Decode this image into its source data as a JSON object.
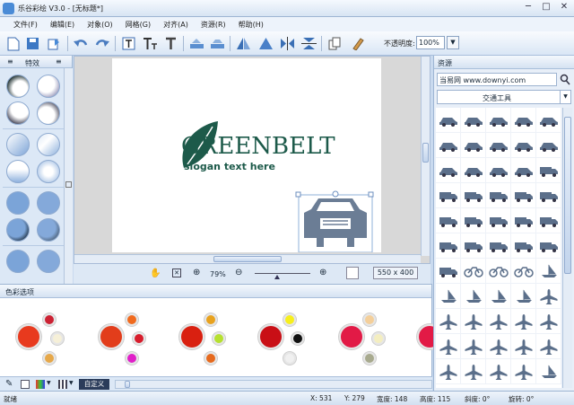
{
  "window": {
    "title": "乐谷彩绘 V3.0 - [无标题*]",
    "controls": [
      "─",
      "□",
      "✕"
    ]
  },
  "menu": [
    "文件(F)",
    "编辑(E)",
    "对象(O)",
    "网格(G)",
    "对齐(A)",
    "资源(R)",
    "帮助(H)"
  ],
  "toolbar": {
    "opacity_label": "不透明度:",
    "opacity_value": "100%",
    "buttons": [
      "new-file-icon",
      "save-icon",
      "export-icon",
      "undo-icon",
      "redo-icon",
      "text-box-icon",
      "text-style-icon",
      "text-icon",
      "flip-h-icon",
      "flip-v-icon",
      "align-left-icon",
      "align-center-icon",
      "mirror-icon",
      "mirror-v-icon",
      "copy-icon",
      "clear-icon"
    ]
  },
  "effects": {
    "title": "特效"
  },
  "canvas": {
    "logo_text": "GREENBELT",
    "slogan": "slogan text here",
    "brand_color": "#1d5a4a",
    "car_color": "#6b7d95"
  },
  "zoom": {
    "value": "79%",
    "size": "550 x 400"
  },
  "colors": {
    "title": "色彩选项",
    "custom_label": "自定义",
    "sets": [
      {
        "main": "#e83a1e",
        "a": "#cc2233",
        "b": "#f6f0d8",
        "c": "#e6a84a"
      },
      {
        "main": "#e23d1b",
        "a": "#f06a1e",
        "b": "#d71d2c",
        "c": "#e020c8"
      },
      {
        "main": "#d92010",
        "a": "#e8a21e",
        "b": "#b6e030",
        "c": "#e66a1e"
      },
      {
        "main": "#c90f16",
        "a": "#f7ef1c",
        "b": "#111111",
        "c": "#f0f0f0"
      },
      {
        "main": "#e21a46",
        "a": "#f4cf9a",
        "b": "#f4eec0",
        "c": "#a8aa8e"
      },
      {
        "main": "#e21a46",
        "a": "",
        "b": "",
        "c": ""
      }
    ]
  },
  "resources": {
    "title": "资源",
    "search_value": "当易网 www.downyi.com",
    "category": "交通工具"
  },
  "status": {
    "ready": "就绪",
    "x": "X: 531",
    "y": "Y: 279",
    "width": "宽度: 148",
    "height": "高度: 115",
    "skew": "斜度: 0°",
    "rotate": "旋转: 0°"
  }
}
